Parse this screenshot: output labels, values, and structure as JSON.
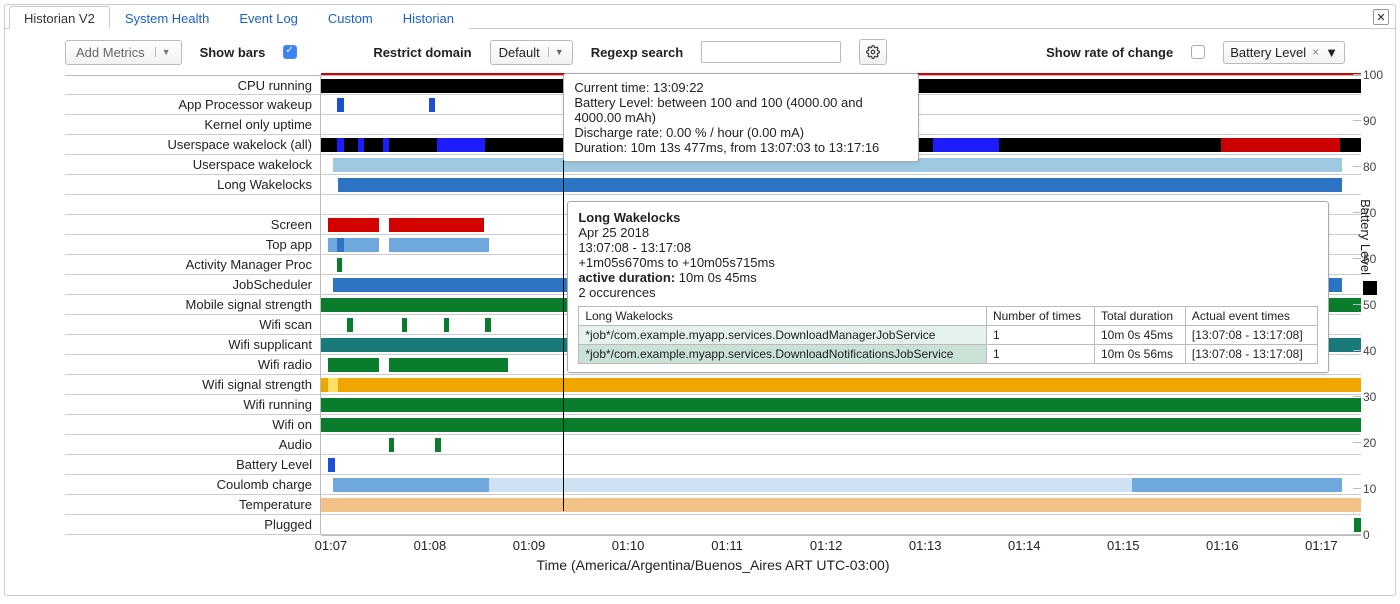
{
  "tabs": [
    "Historian V2",
    "System Health",
    "Event Log",
    "Custom",
    "Historian"
  ],
  "active_tab": 0,
  "toolbar": {
    "add_metrics": "Add Metrics",
    "show_bars": "Show bars",
    "restrict_domain": "Restrict domain",
    "domain_value": "Default",
    "regexp_search": "Regexp search",
    "show_rate": "Show rate of change",
    "series_tag": "Battery Level"
  },
  "yaxis_label": "Battery Level",
  "xaxis_label": "Time (America/Argentina/Buenos_Aires ART UTC-03:00)",
  "y_ticks": [
    "100",
    "90",
    "80",
    "70",
    "60",
    "50",
    "40",
    "30",
    "20",
    "10",
    "0"
  ],
  "x_ticks": [
    "01:07",
    "01:08",
    "01:09",
    "01:10",
    "01:11",
    "01:12",
    "01:13",
    "01:14",
    "01:15",
    "01:16",
    "01:17"
  ],
  "rows": [
    "CPU running",
    "App Processor wakeup",
    "Kernel only uptime",
    "Userspace wakelock (all)",
    "Userspace wakelock",
    "Long Wakelocks",
    "",
    "Screen",
    "Top app",
    "Activity Manager Proc",
    "JobScheduler",
    "Mobile signal strength",
    "Wifi scan",
    "Wifi supplicant",
    "Wifi radio",
    "Wifi signal strength",
    "Wifi running",
    "Wifi on",
    "Audio",
    "Battery Level",
    "Coulomb charge",
    "Temperature",
    "Plugged"
  ],
  "tooltip1": {
    "l1": "Current time: 13:09:22",
    "l2": "Battery Level: between 100 and 100 (4000.00 and 4000.00 mAh)",
    "l3": "Discharge rate: 0.00 % / hour (0.00 mA)",
    "l4": "Duration: 10m 13s 477ms, from 13:07:03 to 13:17:16"
  },
  "tooltip2": {
    "title": "Long Wakelocks",
    "date": "Apr 25 2018",
    "range": "13:07:08 - 13:17:08",
    "offsets": "+1m05s670ms to +10m05s715ms",
    "active_label": "active duration:",
    "active_val": "10m 0s 45ms",
    "occurrences": "2 occurences",
    "headers": [
      "Long Wakelocks",
      "Number of times",
      "Total duration",
      "Actual event times"
    ],
    "rows": [
      [
        "*job*/com.example.myapp.services.DownloadManagerJobService",
        "1",
        "10m 0s 45ms",
        "[13:07:08 - 13:17:08]"
      ],
      [
        "*job*/com.example.myapp.services.DownloadNotificationsJobService",
        "1",
        "10m 0s 56ms",
        "[13:07:08 - 13:17:08]"
      ]
    ]
  },
  "chart_data": {
    "type": "bar",
    "x_domain_minutes": [
      66.9,
      77.4
    ],
    "track_width_pct": 100,
    "rows": {
      "CPU running": [
        {
          "start": 0,
          "end": 100,
          "color": "#000000"
        }
      ],
      "App Processor wakeup": [
        {
          "start": 1.5,
          "end": 2.2,
          "color": "#1c4fd6"
        },
        {
          "start": 10.4,
          "end": 11.0,
          "color": "#1c4fd6"
        }
      ],
      "Kernel only uptime": [],
      "Userspace wakelock (all)": [
        {
          "start": 0,
          "end": 100,
          "color": "#000000"
        },
        {
          "start": 1.5,
          "end": 2.2,
          "color": "#1c1cff"
        },
        {
          "start": 3.6,
          "end": 4.1,
          "color": "#1c1cff"
        },
        {
          "start": 6.0,
          "end": 6.5,
          "color": "#1c1cff"
        },
        {
          "start": 11.2,
          "end": 15.8,
          "color": "#1c1cff"
        },
        {
          "start": 58.8,
          "end": 65.2,
          "color": "#1c1cff"
        },
        {
          "start": 86.5,
          "end": 98.0,
          "color": "#cc0000"
        }
      ],
      "Userspace wakelock": [
        {
          "start": 1.2,
          "end": 98.2,
          "color": "#9ec9e2"
        }
      ],
      "Long Wakelocks": [
        {
          "start": 1.6,
          "end": 98.2,
          "color": "#2e74c4"
        }
      ],
      "Screen": [
        {
          "start": 0.7,
          "end": 5.6,
          "color": "#d40000"
        },
        {
          "start": 6.5,
          "end": 15.7,
          "color": "#d40000"
        }
      ],
      "Top app": [
        {
          "start": 0.7,
          "end": 5.6,
          "color": "#6fa8dc"
        },
        {
          "start": 1.5,
          "end": 2.2,
          "color": "#2e74c4"
        },
        {
          "start": 6.5,
          "end": 16.2,
          "color": "#6fa8dc"
        }
      ],
      "Activity Manager Proc": [
        {
          "start": 1.5,
          "end": 2.0,
          "color": "#0a7d2c"
        }
      ],
      "JobScheduler": [
        {
          "start": 1.2,
          "end": 98.2,
          "color": "#2e74c4"
        }
      ],
      "Mobile signal strength": [
        {
          "start": 0,
          "end": 100,
          "color": "#0a7d2c"
        }
      ],
      "Wifi scan": [
        {
          "start": 2.5,
          "end": 3.1,
          "color": "#0a7d2c"
        },
        {
          "start": 7.8,
          "end": 8.3,
          "color": "#0a7d2c"
        },
        {
          "start": 11.8,
          "end": 12.3,
          "color": "#0a7d2c"
        },
        {
          "start": 15.8,
          "end": 16.3,
          "color": "#0a7d2c"
        }
      ],
      "Wifi supplicant": [
        {
          "start": 0,
          "end": 100,
          "color": "#1a7a7a"
        }
      ],
      "Wifi radio": [
        {
          "start": 0.7,
          "end": 5.6,
          "color": "#0a7d2c"
        },
        {
          "start": 6.5,
          "end": 18.0,
          "color": "#0a7d2c"
        }
      ],
      "Wifi signal strength": [
        {
          "start": 0,
          "end": 100,
          "color": "#f0a500"
        },
        {
          "start": 0.7,
          "end": 1.6,
          "color": "#ffe066"
        }
      ],
      "Wifi running": [
        {
          "start": 0,
          "end": 100,
          "color": "#0a7d2c"
        }
      ],
      "Wifi on": [
        {
          "start": 0,
          "end": 100,
          "color": "#0a7d2c"
        }
      ],
      "Audio": [
        {
          "start": 6.5,
          "end": 7.0,
          "color": "#0a7d2c"
        },
        {
          "start": 11.0,
          "end": 11.5,
          "color": "#0a7d2c"
        }
      ],
      "Battery Level": [
        {
          "start": 0.7,
          "end": 1.3,
          "color": "#1c4fd6"
        }
      ],
      "Coulomb charge": [
        {
          "start": 1.2,
          "end": 16.2,
          "color": "#6fa8dc"
        },
        {
          "start": 16.2,
          "end": 78.0,
          "color": "#cfe2f3"
        },
        {
          "start": 78.0,
          "end": 98.2,
          "color": "#6fa8dc"
        }
      ],
      "Temperature": [
        {
          "start": 0,
          "end": 100,
          "color": "#f2c288"
        }
      ],
      "Plugged": [
        {
          "start": 99.3,
          "end": 100,
          "color": "#0a7d2c"
        }
      ]
    },
    "top_red_line": {
      "start": 0,
      "end": 100,
      "color": "#d40000"
    },
    "cursor_pct": 23.3
  }
}
